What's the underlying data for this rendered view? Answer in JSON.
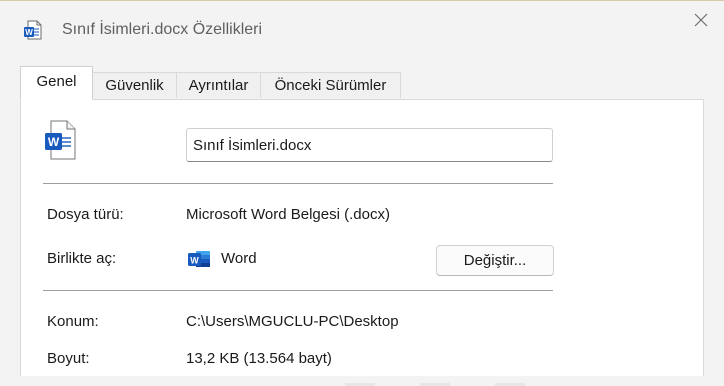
{
  "window": {
    "title": "Sınıf İsimleri.docx Özellikleri"
  },
  "tabs": [
    {
      "label": "Genel",
      "active": true
    },
    {
      "label": "Güvenlik",
      "active": false
    },
    {
      "label": "Ayrıntılar",
      "active": false
    },
    {
      "label": "Önceki Sürümler",
      "active": false
    }
  ],
  "general": {
    "file_name": "Sınıf İsimleri.docx",
    "file_type_label": "Dosya türü:",
    "file_type_value": "Microsoft Word Belgesi (.docx)",
    "opens_with_label": "Birlikte aç:",
    "opens_with_value": "Word",
    "change_button": "Değiştir...",
    "location_label": "Konum:",
    "location_value": "C:\\Users\\MGUCLU-PC\\Desktop",
    "size_label": "Boyut:",
    "size_value": "13,2 KB (13.564 bayt)"
  },
  "icons": {
    "title": "word-document-icon",
    "file": "word-document-icon",
    "app": "word-app-icon",
    "close": "close-icon"
  },
  "colors": {
    "word_blue": "#185abd",
    "window_bg": "#f3f3f3",
    "panel_bg": "#ffffff"
  }
}
